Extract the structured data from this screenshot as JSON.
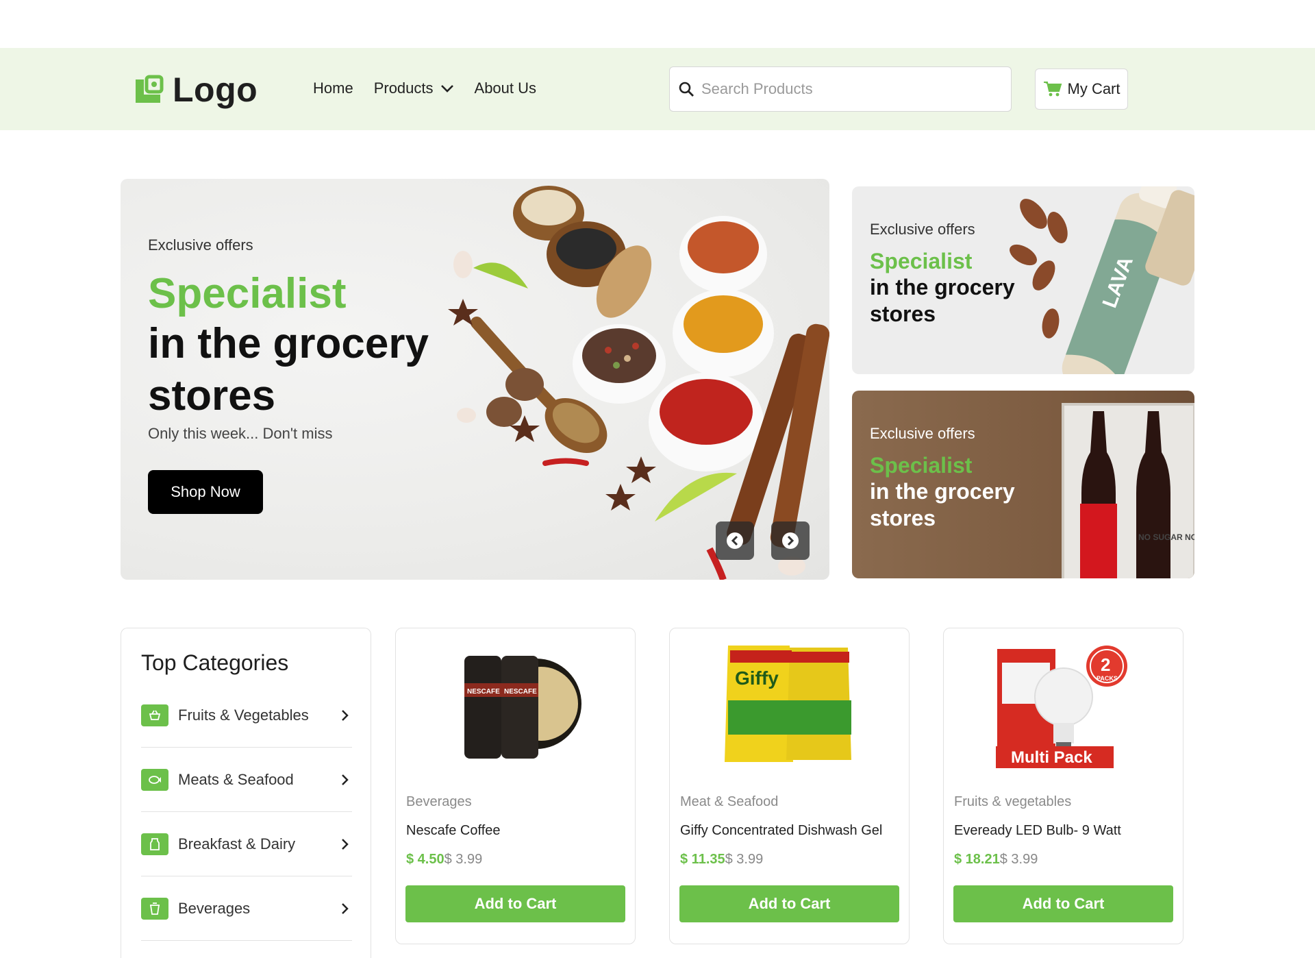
{
  "header": {
    "logo_text": "Logo",
    "nav": [
      {
        "label": "Home"
      },
      {
        "label": "Products"
      },
      {
        "label": "About Us"
      }
    ],
    "search_placeholder": "Search Products",
    "cart_label": "My Cart"
  },
  "hero": {
    "eyebrow": "Exclusive offers",
    "title_green": "Specialist",
    "title_dark": "in the grocery stores",
    "subtitle": "Only this week... Don't miss",
    "cta": "Shop Now"
  },
  "side_banners": [
    {
      "eyebrow": "Exclusive offers",
      "title_green": "Specialist",
      "title_dark": "in the grocery stores",
      "image_text": "LAVA"
    },
    {
      "eyebrow": "Exclusive offers",
      "title_green": "Specialist",
      "title_dark": "in the grocery stores",
      "image_text": "NO SUGAR NO CALORIES"
    }
  ],
  "categories": {
    "title": "Top Categories",
    "items": [
      {
        "label": "Fruits & Vegetables",
        "icon": "basket-icon"
      },
      {
        "label": "Meats & Seafood",
        "icon": "fish-icon"
      },
      {
        "label": "Breakfast & Dairy",
        "icon": "milk-icon"
      },
      {
        "label": "Beverages",
        "icon": "cup-icon"
      }
    ]
  },
  "products": [
    {
      "category": "Beverages",
      "name": "Nescafe Coffee",
      "price": "$ 4.50",
      "old_price": "$ 3.99",
      "button": "Add to Cart",
      "image_text": "NESCAFE"
    },
    {
      "category": "Meat & Seafood",
      "name": "Giffy Concentrated Dishwash Gel",
      "price": "$ 11.35",
      "old_price": "$ 3.99",
      "button": "Add to Cart",
      "image_text": "Giffy"
    },
    {
      "category": "Fruits & vegetables",
      "name": "Eveready LED Bulb- 9 Watt",
      "price": "$ 18.21",
      "old_price": "$ 3.99",
      "button": "Add to Cart",
      "image_text": "Multi Pack",
      "badge": "2",
      "badge_sub": "PACKS"
    }
  ],
  "colors": {
    "accent": "#6cc04a",
    "header_bg": "#eef6e6",
    "dark": "#000000"
  }
}
